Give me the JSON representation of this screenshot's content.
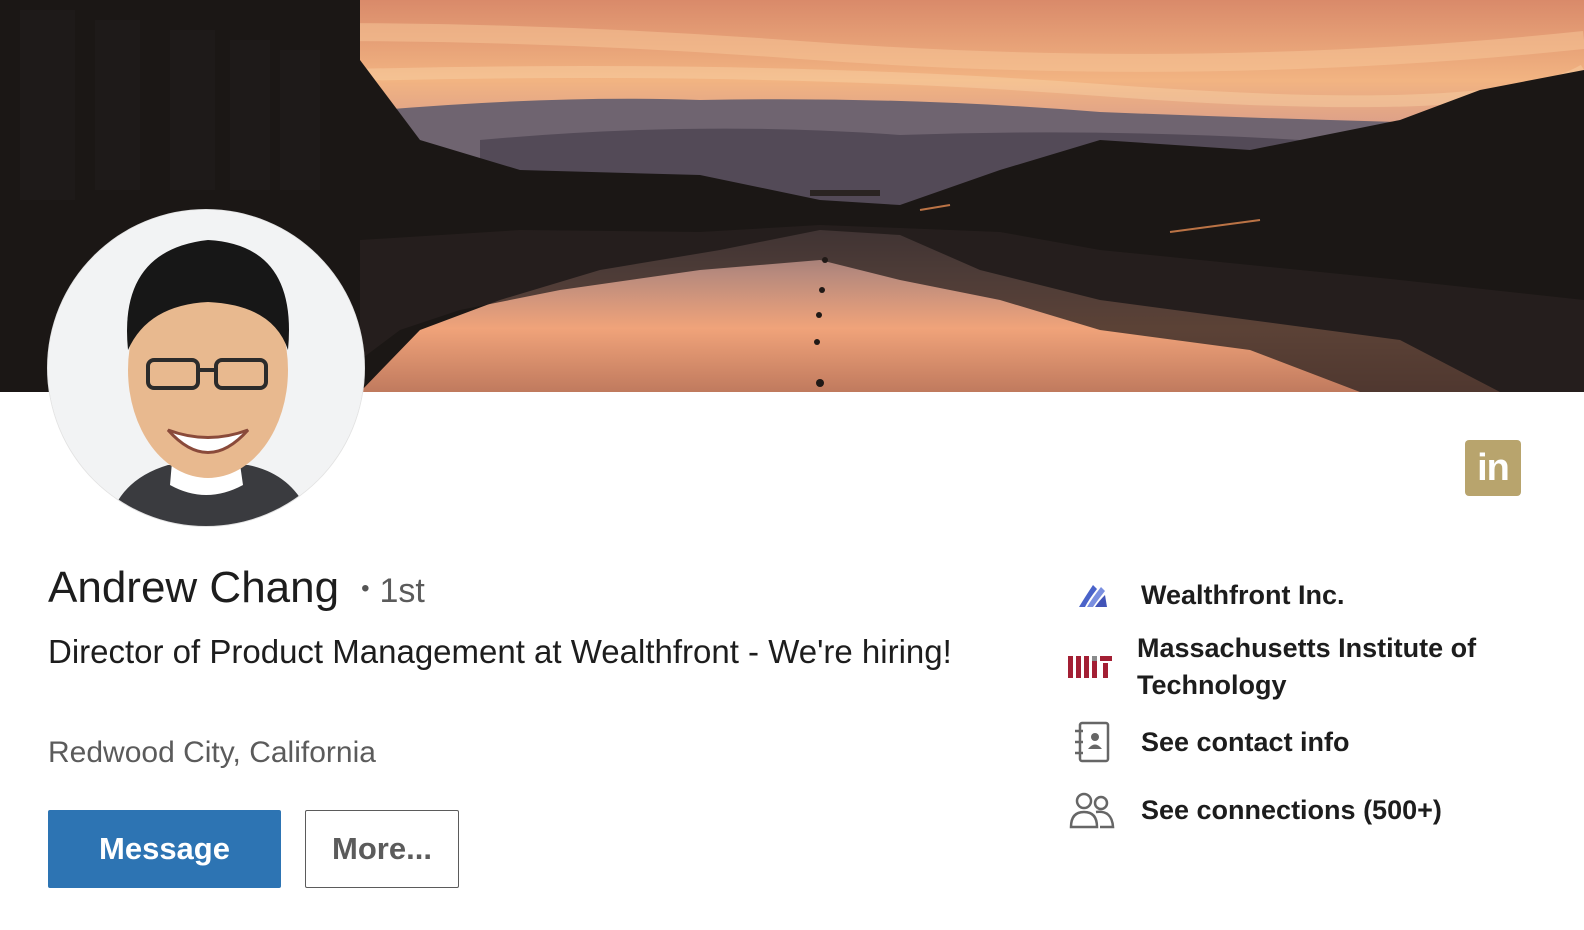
{
  "profile": {
    "name": "Andrew Chang",
    "degree_separator": "•",
    "degree": "1st",
    "headline": "Director of Product Management at Wealthfront - We're hiring!",
    "location": "Redwood City, California",
    "avatar_icon": "profile-photo",
    "banner_icon": "sunset-lake-cover-photo"
  },
  "actions": {
    "message_label": "Message",
    "more_label": "More..."
  },
  "brand": {
    "badge_text": "in",
    "badge_icon": "linkedin-icon",
    "badge_color": "#b8a46d"
  },
  "sidebar": {
    "items": [
      {
        "icon": "wealthfront-logo-icon",
        "label": "Wealthfront Inc."
      },
      {
        "icon": "mit-logo-icon",
        "label": "Massachusetts Institute of Technology"
      },
      {
        "icon": "contact-book-icon",
        "label": "See contact info"
      },
      {
        "icon": "connections-icon",
        "label": "See connections (500+)"
      }
    ]
  },
  "colors": {
    "primary_button": "#2d74b3",
    "primary_button_text": "#ffffff",
    "secondary_button_text": "#5b5b5b",
    "mit_red": "#a31f34",
    "wealthfront_purple": "#5e4fc9"
  }
}
